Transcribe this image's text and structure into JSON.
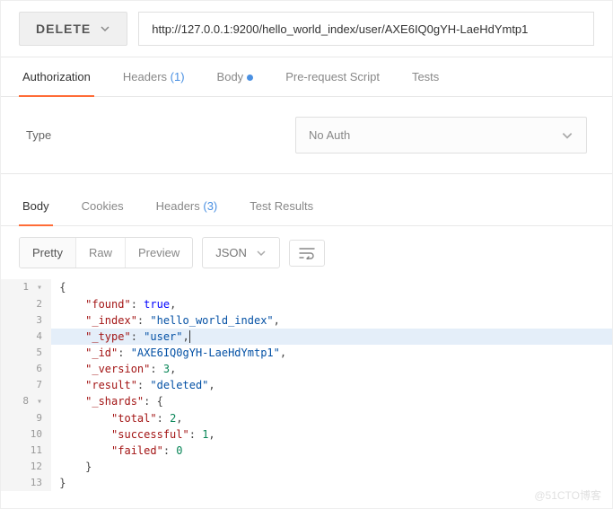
{
  "request": {
    "method": "DELETE",
    "url": "http://127.0.0.1:9200/hello_world_index/user/AXE6IQ0gYH-LaeHdYmtp1"
  },
  "req_tabs": {
    "authorization": "Authorization",
    "headers": "Headers",
    "headers_count": "(1)",
    "body": "Body",
    "pre_request": "Pre-request Script",
    "tests": "Tests"
  },
  "auth": {
    "type_label": "Type",
    "selected": "No Auth"
  },
  "resp_tabs": {
    "body": "Body",
    "cookies": "Cookies",
    "headers": "Headers",
    "headers_count": "(3)",
    "test_results": "Test Results"
  },
  "view": {
    "pretty": "Pretty",
    "raw": "Raw",
    "preview": "Preview",
    "format": "JSON"
  },
  "response": {
    "found": true,
    "_index": "hello_world_index",
    "_type": "user",
    "_id": "AXE6IQ0gYH-LaeHdYmtp1",
    "_version": 3,
    "result": "deleted",
    "_shards": {
      "total": 2,
      "successful": 1,
      "failed": 0
    }
  },
  "watermark": "@51CTO博客"
}
